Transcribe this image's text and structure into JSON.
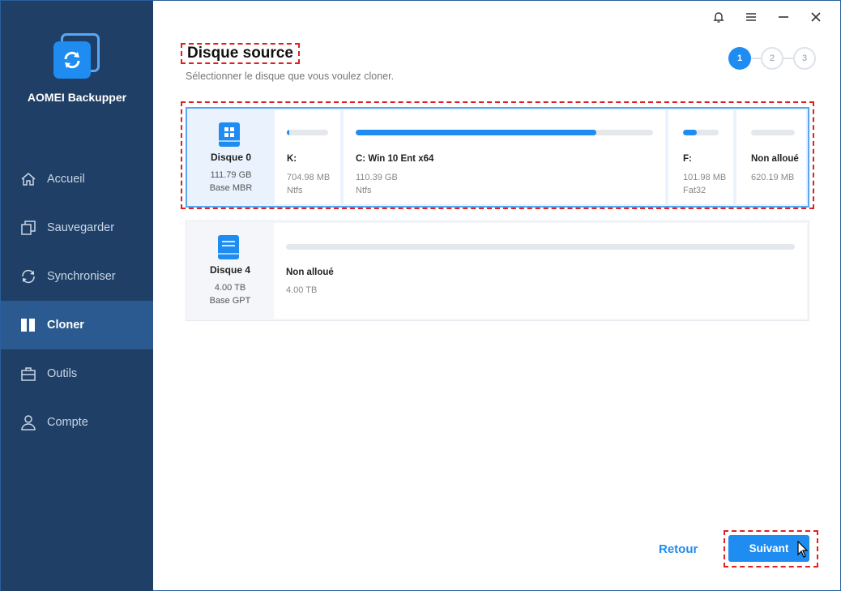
{
  "app": {
    "name": "AOMEI Backupper"
  },
  "sidebar": {
    "items": [
      {
        "label": "Accueil",
        "icon": "home-icon"
      },
      {
        "label": "Sauvegarder",
        "icon": "backup-icon"
      },
      {
        "label": "Synchroniser",
        "icon": "sync-icon"
      },
      {
        "label": "Cloner",
        "icon": "clone-icon",
        "active": true
      },
      {
        "label": "Outils",
        "icon": "tools-icon"
      },
      {
        "label": "Compte",
        "icon": "user-icon"
      }
    ]
  },
  "titlebar": {
    "icons": [
      "bell-icon",
      "menu-icon",
      "minimize-icon",
      "close-icon"
    ]
  },
  "page": {
    "title": "Disque source",
    "subtitle": "Sélectionner le disque que vous voulez cloner."
  },
  "steps": [
    "1",
    "2",
    "3"
  ],
  "disks": [
    {
      "name": "Disque 0",
      "size": "111.79 GB",
      "style": "Base MBR",
      "selected": true,
      "partitions": [
        {
          "label": "K:",
          "size": "704.98 MB",
          "fs": "Ntfs",
          "used_fraction": 0.05
        },
        {
          "label": "C: Win 10 Ent x64",
          "size": "110.39 GB",
          "fs": "Ntfs",
          "used_fraction": 0.81
        },
        {
          "label": "F:",
          "size": "101.98 MB",
          "fs": "Fat32",
          "used_fraction": 0.38
        },
        {
          "label": "Non alloué",
          "size": "620.19 MB",
          "fs": "",
          "used_fraction": 0
        }
      ]
    },
    {
      "name": "Disque 4",
      "size": "4.00 TB",
      "style": "Base GPT",
      "selected": false,
      "partitions": [
        {
          "label": "Non alloué",
          "size": "4.00 TB",
          "fs": "",
          "used_fraction": 0
        }
      ]
    }
  ],
  "buttons": {
    "back": "Retour",
    "next": "Suivant"
  },
  "colors": {
    "accent": "#1e8cf0",
    "sidebar": "#1f3f66",
    "sidebar_active": "#2a5a8f",
    "highlight": "#e02020"
  }
}
